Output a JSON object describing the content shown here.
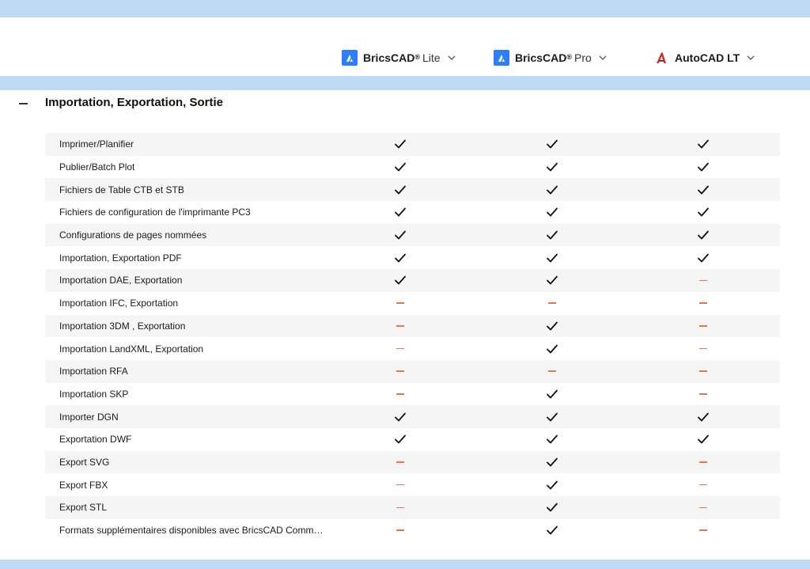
{
  "products": [
    {
      "brand": "BricsCAD",
      "sup": "®",
      "edition": "Lite",
      "logo": "bricscad-logo-icon"
    },
    {
      "brand": "BricsCAD",
      "sup": "®",
      "edition": "Pro",
      "logo": "bricscad-logo-icon"
    },
    {
      "brand": "AutoCAD LT",
      "sup": "",
      "edition": "",
      "logo": "autocad-logo-icon"
    }
  ],
  "section": {
    "title": "Importation, Exportation, Sortie",
    "toggle_icon": "minus-icon"
  },
  "rows": [
    {
      "label": "Imprimer/Planifier",
      "values": [
        true,
        true,
        true
      ]
    },
    {
      "label": "Publier/Batch Plot",
      "values": [
        true,
        true,
        true
      ]
    },
    {
      "label": "Fichiers de Table CTB et STB",
      "values": [
        true,
        true,
        true
      ]
    },
    {
      "label": "Fichiers de configuration de l'imprimante PC3",
      "values": [
        true,
        true,
        true
      ]
    },
    {
      "label": "Configurations de pages nommées",
      "values": [
        true,
        true,
        true
      ]
    },
    {
      "label": "Importation, Exportation PDF",
      "values": [
        true,
        true,
        true
      ]
    },
    {
      "label": "Importation DAE, Exportation",
      "values": [
        true,
        true,
        false
      ]
    },
    {
      "label": "Importation IFC, Exportation",
      "values": [
        false,
        false,
        false
      ]
    },
    {
      "label": "Importation 3DM , Exportation",
      "values": [
        false,
        true,
        false
      ]
    },
    {
      "label": "Importation LandXML, Exportation",
      "values": [
        false,
        true,
        false
      ]
    },
    {
      "label": "Importation RFA",
      "values": [
        false,
        false,
        false
      ]
    },
    {
      "label": "Importation SKP",
      "values": [
        false,
        true,
        false
      ]
    },
    {
      "label": "Importer DGN",
      "values": [
        true,
        true,
        true
      ]
    },
    {
      "label": "Exportation DWF",
      "values": [
        true,
        true,
        true
      ]
    },
    {
      "label": "Export SVG",
      "values": [
        false,
        true,
        false
      ]
    },
    {
      "label": "Export FBX",
      "values": [
        false,
        true,
        false
      ]
    },
    {
      "label": "Export STL",
      "values": [
        false,
        true,
        false
      ]
    },
    {
      "label": "Formats supplémentaires disponibles avec BricsCAD Communic...",
      "values": [
        false,
        true,
        false
      ]
    }
  ],
  "colors": {
    "band": "#bfd8f4",
    "bricscad_blue": "#2d7ff9",
    "autocad_red": "#d0312d",
    "dash": "#e8744e",
    "row_alt": "#f5f5f5"
  }
}
